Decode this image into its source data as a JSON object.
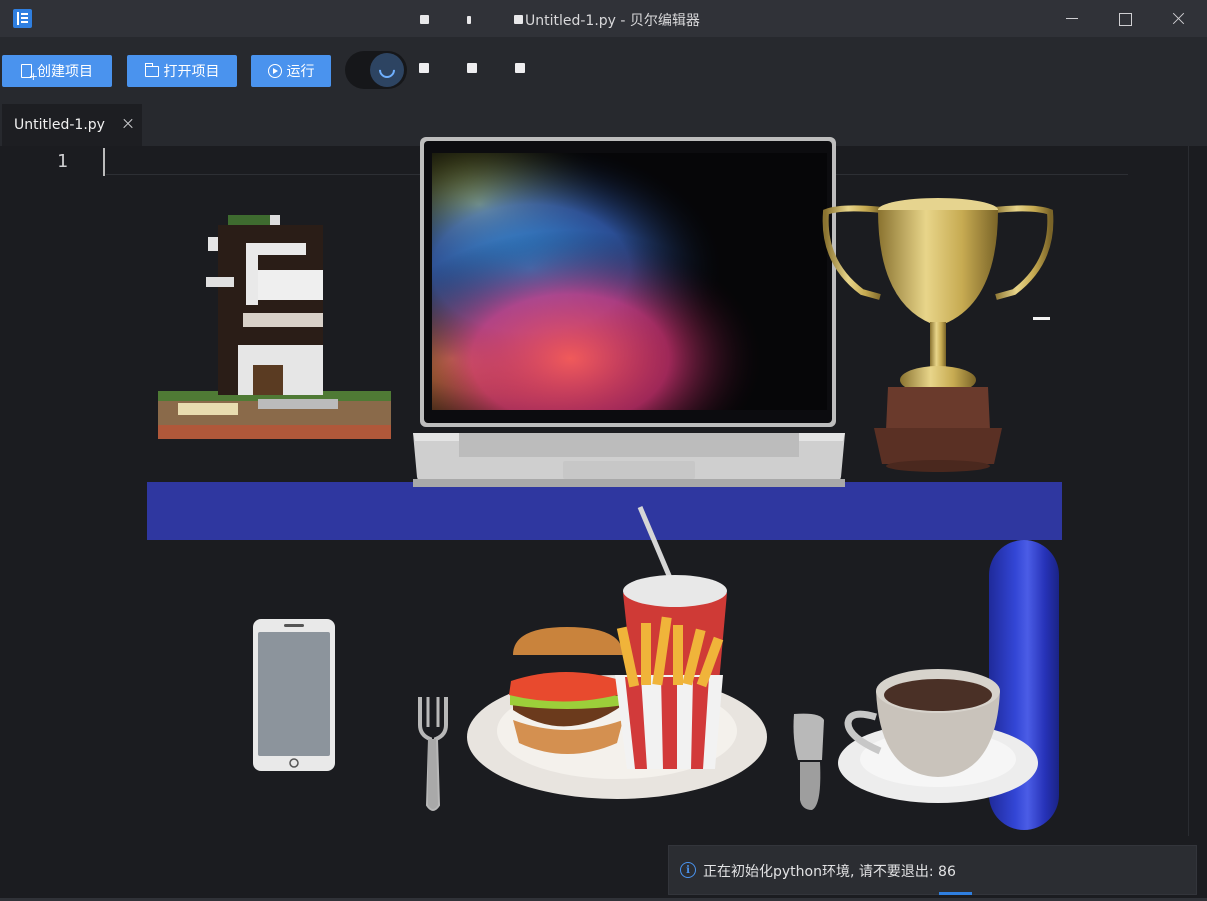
{
  "window": {
    "title": "Untitled-1.py - 贝尔编辑器"
  },
  "toolbar": {
    "create_project": "创建项目",
    "open_project": "打开项目",
    "run": "运行"
  },
  "tabs": [
    {
      "label": "Untitled-1.py",
      "active": true
    }
  ],
  "editor": {
    "line_numbers": [
      "1"
    ]
  },
  "notification": {
    "message": "正在初始化python环境, 请不要退出: 86"
  },
  "colors": {
    "accent": "#4a93ee",
    "shelf": "#2f37a0",
    "capsule": "#3346d6",
    "background": "#1b1c20"
  },
  "icons": {
    "app": "app-logo-icon",
    "create": "new-file-icon",
    "open": "folder-icon",
    "run": "play-circle-icon",
    "theme": "moon-icon",
    "close_tab": "close-icon",
    "info": "info-icon"
  }
}
